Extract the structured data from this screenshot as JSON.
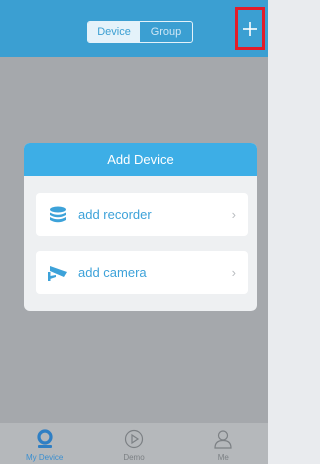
{
  "header": {
    "segments": [
      {
        "label": "Device",
        "active": true
      },
      {
        "label": "Group",
        "active": false
      }
    ],
    "add_icon": "plus-icon"
  },
  "dialog": {
    "title": "Add Device",
    "options": [
      {
        "label": "add recorder",
        "icon": "database-icon",
        "chevron": "›"
      },
      {
        "label": "add camera",
        "icon": "camera-icon",
        "chevron": "›"
      }
    ]
  },
  "tabbar": {
    "tabs": [
      {
        "label": "My Device",
        "icon": "user-pin-icon",
        "active": true
      },
      {
        "label": "Demo",
        "icon": "play-circle-icon",
        "active": false
      },
      {
        "label": "Me",
        "icon": "person-icon",
        "active": false
      }
    ]
  },
  "colors": {
    "header": "#3b9fd2",
    "dialog_header": "#3daee6",
    "accent_text": "#3da2d9",
    "highlight_box": "#e11d2a",
    "overlay": "#a5a8ac"
  }
}
